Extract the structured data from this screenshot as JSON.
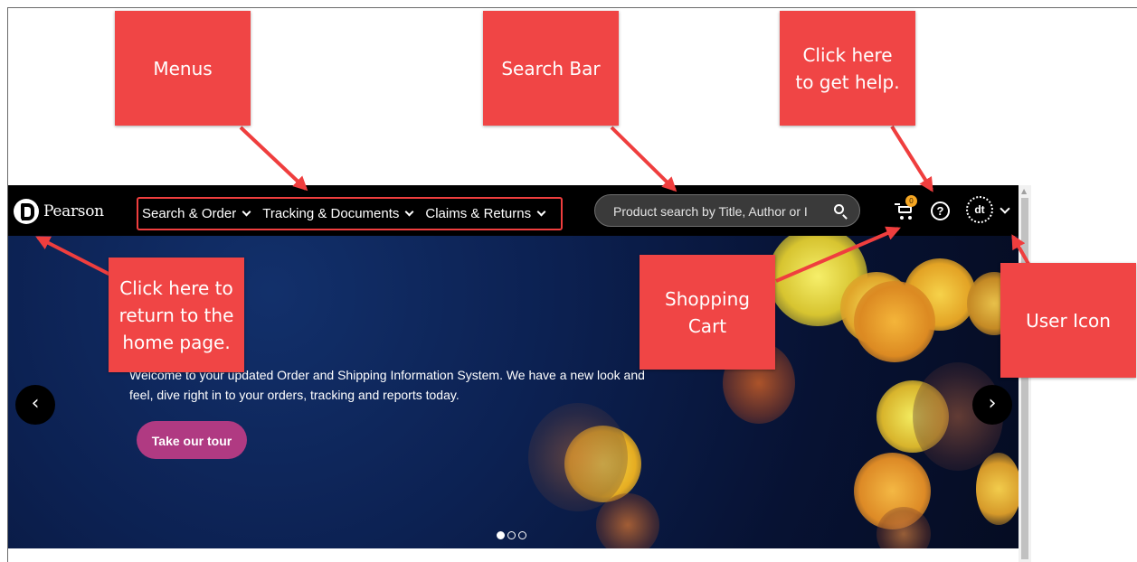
{
  "brand": {
    "logo_text": "Pearson"
  },
  "nav": {
    "menus": [
      "Search & Order",
      "Tracking & Documents",
      "Claims & Returns"
    ],
    "search_placeholder": "Product search by Title, Author or I",
    "cart_count": "0",
    "help_symbol": "?",
    "user_initials": "dt"
  },
  "hero": {
    "welcome_text": "Welcome to your updated Order and Shipping Information System. We have a new look and feel, dive right in to your orders, tracking and reports today.",
    "tour_button": "Take our tour",
    "prev_symbol": "‹",
    "next_symbol": "›",
    "slide_count": 3,
    "active_slide": 1
  },
  "callouts": {
    "menus": "Menus",
    "search_bar": "Search Bar",
    "help": "Click here to get help.",
    "home": "Click here to return to the home page.",
    "cart": "Shopping Cart",
    "user": "User Icon"
  },
  "colors": {
    "callout_red": "#f04545",
    "navbar": "#000000",
    "tour_button": "#b03a82",
    "cart_badge": "#f5a623",
    "hero_blue": "#0c2152"
  }
}
